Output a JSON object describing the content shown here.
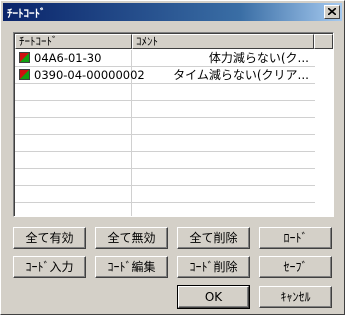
{
  "dialog": {
    "title": "ﾁｰﾄｺｰﾄﾞ"
  },
  "list": {
    "columns": [
      "ﾁｰﾄｺｰﾄﾞ",
      "ｺﾒﾝﾄ"
    ],
    "rows": [
      {
        "code": "04A6-01-30",
        "comment": "体力減らない(ク..."
      },
      {
        "code": "0390-04-00000002",
        "comment": "タイム減らない(クリア..."
      }
    ]
  },
  "buttons": {
    "enable_all": "全て有効",
    "disable_all": "全て無効",
    "delete_all": "全て削除",
    "load": "ﾛｰﾄﾞ",
    "code_input": "ｺｰﾄﾞ入力",
    "code_edit": "ｺｰﾄﾞ編集",
    "code_delete": "ｺｰﾄﾞ削除",
    "save": "ｾｰﾌﾞ",
    "ok": "OK",
    "cancel": "ｷｬﾝｾﾙ"
  }
}
